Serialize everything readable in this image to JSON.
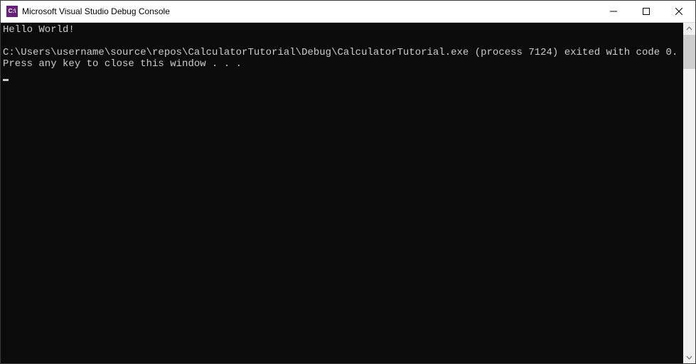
{
  "window": {
    "title": "Microsoft Visual Studio Debug Console",
    "icon_text": "C:\\"
  },
  "console": {
    "line1": "Hello World!",
    "line2": "",
    "line3": "C:\\Users\\username\\source\\repos\\CalculatorTutorial\\Debug\\CalculatorTutorial.exe (process 7124) exited with code 0.",
    "line4": "Press any key to close this window . . ."
  }
}
